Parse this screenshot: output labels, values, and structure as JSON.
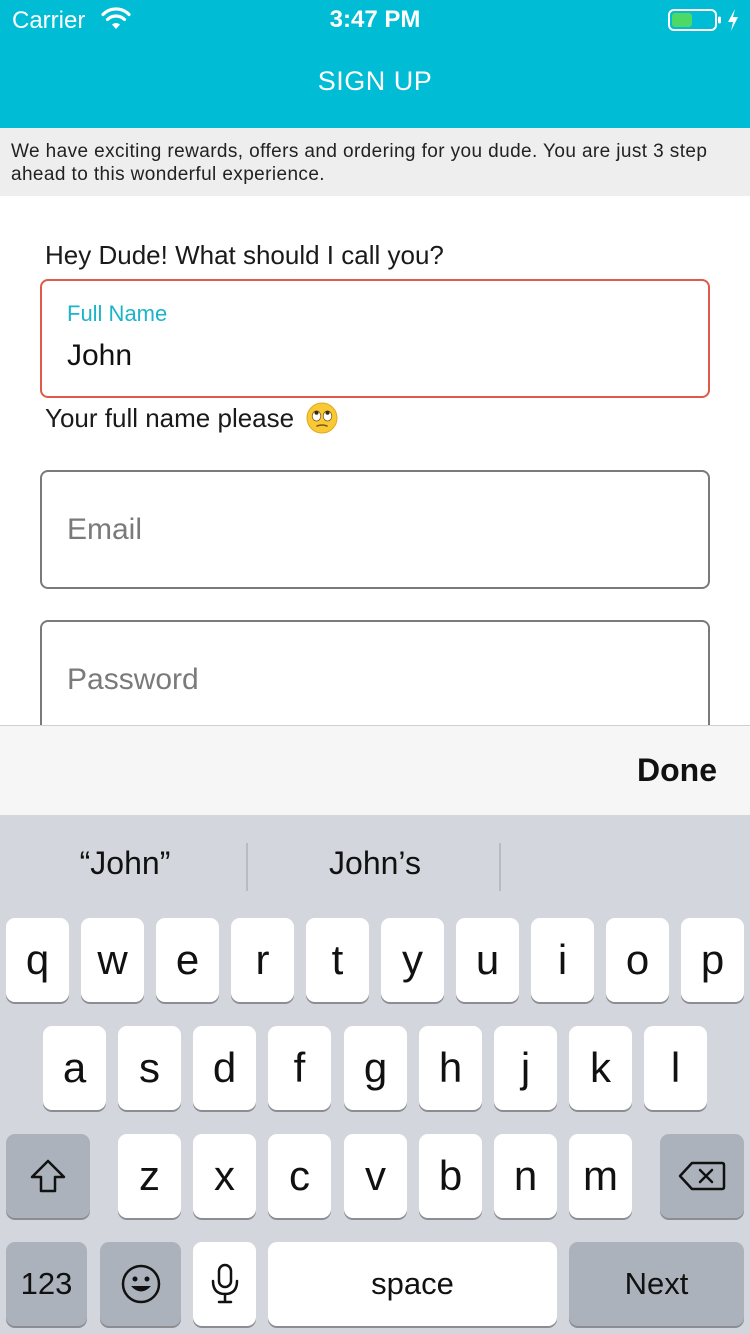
{
  "status_bar": {
    "carrier": "Carrier",
    "time": "3:47 PM",
    "battery_color": "#4cd964"
  },
  "nav": {
    "title": "SIGN UP"
  },
  "banner": {
    "text": "We have exciting rewards, offers and ordering for you dude. You are just 3 step ahead to this wonderful experience."
  },
  "form": {
    "prompt": "Hey Dude! What should I call you?",
    "full_name": {
      "label": "Full Name",
      "value": "John",
      "border_color": "#e05a4a",
      "label_color": "#1ab5c8"
    },
    "helper": "Your full name please",
    "email": {
      "placeholder": "Email"
    },
    "password": {
      "placeholder": "Password"
    }
  },
  "accessory": {
    "done_label": "Done"
  },
  "keyboard": {
    "suggestions": [
      "“John”",
      "John’s",
      ""
    ],
    "rows": [
      [
        "q",
        "w",
        "e",
        "r",
        "t",
        "y",
        "u",
        "i",
        "o",
        "p"
      ],
      [
        "a",
        "s",
        "d",
        "f",
        "g",
        "h",
        "j",
        "k",
        "l"
      ],
      [
        "z",
        "x",
        "c",
        "v",
        "b",
        "n",
        "m"
      ]
    ],
    "numbers_label": "123",
    "space_label": "space",
    "return_label": "Next"
  },
  "colors": {
    "header": "#00bcd4",
    "keyboard_bg": "#d3d6dc"
  }
}
